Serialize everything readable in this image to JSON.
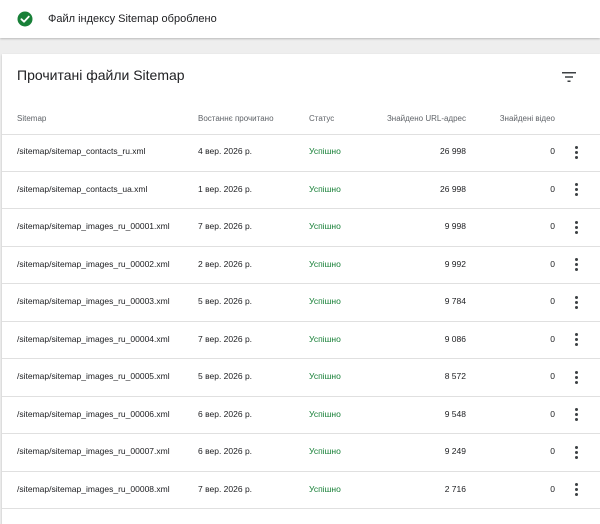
{
  "banner": {
    "icon": "check-circle-icon",
    "message": "Файл індексу Sitemap оброблено",
    "accent": "#188038"
  },
  "card": {
    "title": "Прочитані файли Sitemap",
    "filter_icon": "filter-icon"
  },
  "table": {
    "columns": [
      "Sitemap",
      "Востаннє прочитано",
      "Статус",
      "Знайдено URL-адрес",
      "Знайдені відео"
    ],
    "rows": [
      {
        "sitemap": "/sitemap/sitemap_contacts_ru.xml",
        "last_read": "4 вер. 2026 р.",
        "status": "Успішно",
        "urls": "26 998",
        "videos": "0"
      },
      {
        "sitemap": "/sitemap/sitemap_contacts_ua.xml",
        "last_read": "1 вер. 2026 р.",
        "status": "Успішно",
        "urls": "26 998",
        "videos": "0"
      },
      {
        "sitemap": "/sitemap/sitemap_images_ru_00001.xml",
        "last_read": "7 вер. 2026 р.",
        "status": "Успішно",
        "urls": "9 998",
        "videos": "0"
      },
      {
        "sitemap": "/sitemap/sitemap_images_ru_00002.xml",
        "last_read": "2 вер. 2026 р.",
        "status": "Успішно",
        "urls": "9 992",
        "videos": "0"
      },
      {
        "sitemap": "/sitemap/sitemap_images_ru_00003.xml",
        "last_read": "5 вер. 2026 р.",
        "status": "Успішно",
        "urls": "9 784",
        "videos": "0"
      },
      {
        "sitemap": "/sitemap/sitemap_images_ru_00004.xml",
        "last_read": "7 вер. 2026 р.",
        "status": "Успішно",
        "urls": "9 086",
        "videos": "0"
      },
      {
        "sitemap": "/sitemap/sitemap_images_ru_00005.xml",
        "last_read": "5 вер. 2026 р.",
        "status": "Успішно",
        "urls": "8 572",
        "videos": "0"
      },
      {
        "sitemap": "/sitemap/sitemap_images_ru_00006.xml",
        "last_read": "6 вер. 2026 р.",
        "status": "Успішно",
        "urls": "9 548",
        "videos": "0"
      },
      {
        "sitemap": "/sitemap/sitemap_images_ru_00007.xml",
        "last_read": "6 вер. 2026 р.",
        "status": "Успішно",
        "urls": "9 249",
        "videos": "0"
      },
      {
        "sitemap": "/sitemap/sitemap_images_ru_00008.xml",
        "last_read": "7 вер. 2026 р.",
        "status": "Успішно",
        "urls": "2 716",
        "videos": "0"
      }
    ],
    "row_action_icon": "more-vertical-icon"
  }
}
